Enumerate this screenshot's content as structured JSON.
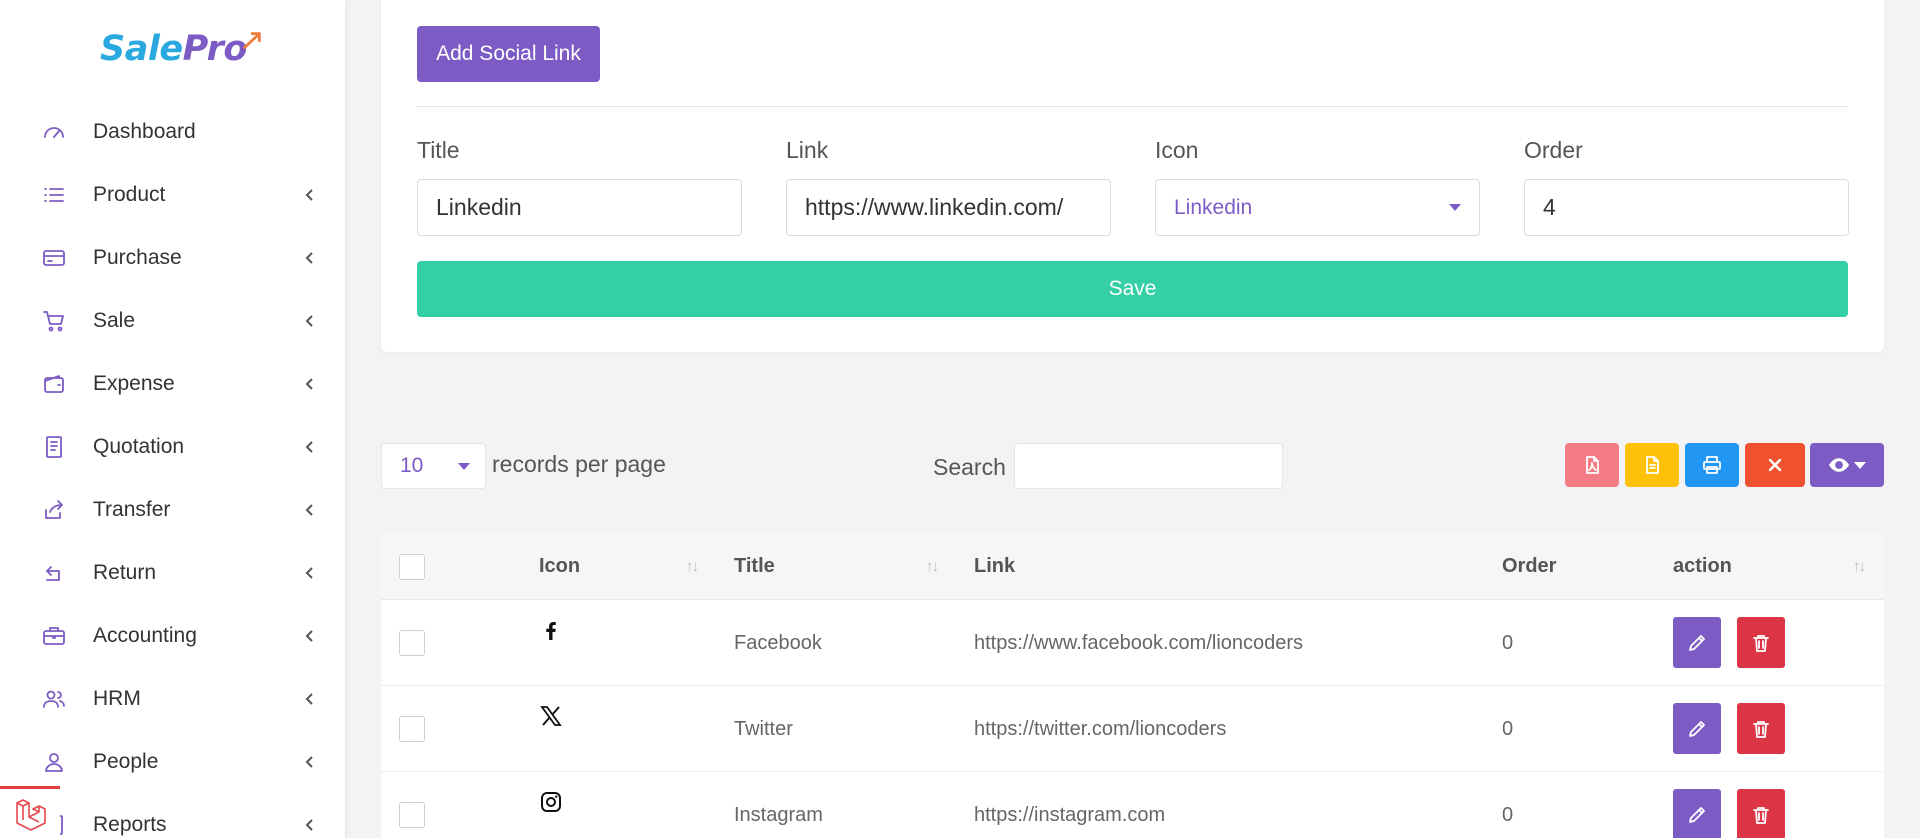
{
  "brand": {
    "logo_main": "Sale",
    "logo_accent": "Pro",
    "primary": "#7c5cc4",
    "success": "#34cfa5"
  },
  "sidebar": {
    "items": [
      {
        "label": "Dashboard",
        "icon": "dashboard-icon",
        "has_children": false
      },
      {
        "label": "Product",
        "icon": "list-icon",
        "has_children": true
      },
      {
        "label": "Purchase",
        "icon": "credit-card-icon",
        "has_children": true
      },
      {
        "label": "Sale",
        "icon": "cart-icon",
        "has_children": true
      },
      {
        "label": "Expense",
        "icon": "wallet-icon",
        "has_children": true
      },
      {
        "label": "Quotation",
        "icon": "document-icon",
        "has_children": true
      },
      {
        "label": "Transfer",
        "icon": "share-icon",
        "has_children": true
      },
      {
        "label": "Return",
        "icon": "return-icon",
        "has_children": true
      },
      {
        "label": "Accounting",
        "icon": "briefcase-icon",
        "has_children": true
      },
      {
        "label": "HRM",
        "icon": "users-icon",
        "has_children": true
      },
      {
        "label": "People",
        "icon": "user-icon",
        "has_children": true
      },
      {
        "label": "Reports",
        "icon": "report-icon",
        "has_children": true
      }
    ]
  },
  "form": {
    "add_button": "Add Social Link",
    "title_label": "Title",
    "title_value": "Linkedin",
    "link_label": "Link",
    "link_value": "https://www.linkedin.com/",
    "icon_label": "Icon",
    "icon_value": "Linkedin",
    "order_label": "Order",
    "order_value": "4",
    "save_button": "Save"
  },
  "table_controls": {
    "per_page_value": "10",
    "per_page_label": "records per page",
    "search_label": "Search",
    "search_value": "",
    "buttons": [
      {
        "name": "pdf-export-button",
        "icon": "pdf-icon",
        "color": "#f47c85"
      },
      {
        "name": "csv-export-button",
        "icon": "file-icon",
        "color": "#ffc107"
      },
      {
        "name": "print-button",
        "icon": "print-icon",
        "color": "#2196f3"
      },
      {
        "name": "delete-selected-button",
        "icon": "close-icon",
        "color": "#f0522f"
      },
      {
        "name": "column-visibility-button",
        "icon": "eye-icon",
        "color": "#7c5cc4"
      }
    ]
  },
  "table": {
    "headers": {
      "icon": "Icon",
      "title": "Title",
      "link": "Link",
      "order": "Order",
      "action": "action"
    },
    "rows": [
      {
        "icon": "facebook-icon",
        "title": "Facebook",
        "link": "https://www.facebook.com/lioncoders",
        "order": "0"
      },
      {
        "icon": "x-twitter-icon",
        "title": "Twitter",
        "link": "https://twitter.com/lioncoders",
        "order": "0"
      },
      {
        "icon": "instagram-icon",
        "title": "Instagram",
        "link": "https://instagram.com",
        "order": "0"
      }
    ],
    "edit_color": "#7c5cc4",
    "delete_color": "#dc3545"
  }
}
